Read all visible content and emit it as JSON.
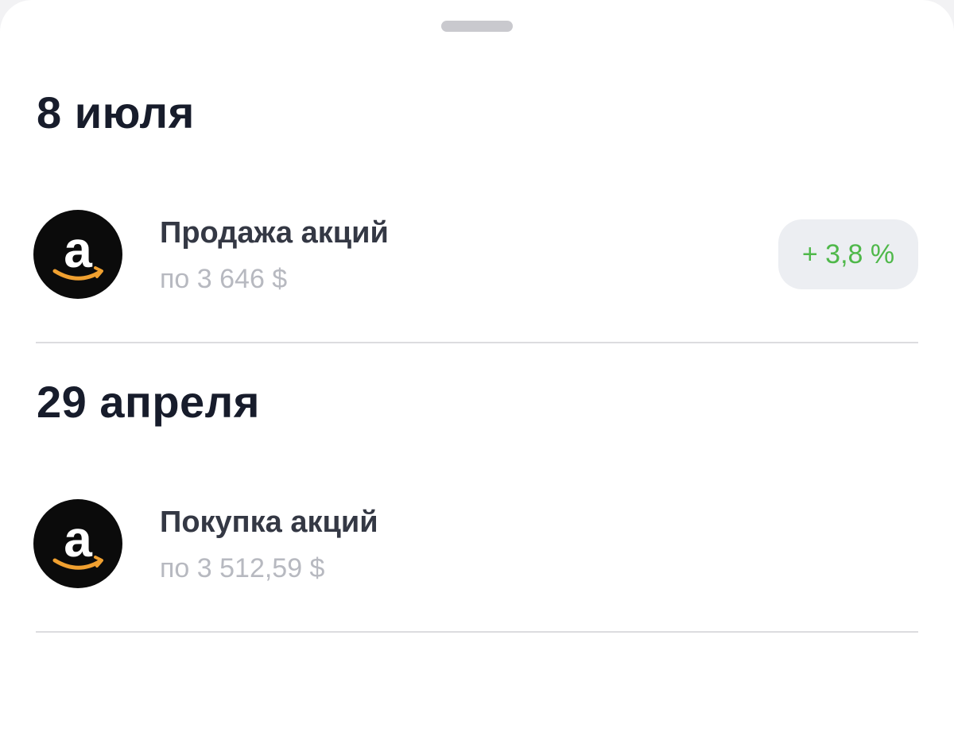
{
  "groups": [
    {
      "date": "8 июля",
      "transaction": {
        "icon": "amazon-logo-icon",
        "title": "Продажа акций",
        "subtitle": "по 3 646 $",
        "change": "+ 3,8 %"
      }
    },
    {
      "date": "29 апреля",
      "transaction": {
        "icon": "amazon-logo-icon",
        "title": "Покупка акций",
        "subtitle": "по 3 512,59 $"
      }
    }
  ],
  "colors": {
    "heading": "#171c2b",
    "title": "#343844",
    "subtitle": "#b7b9c0",
    "positive": "#4fb84a",
    "badge_bg": "#eceef2",
    "logo_bg": "#0b0b0b",
    "logo_smile": "#f0a030"
  }
}
